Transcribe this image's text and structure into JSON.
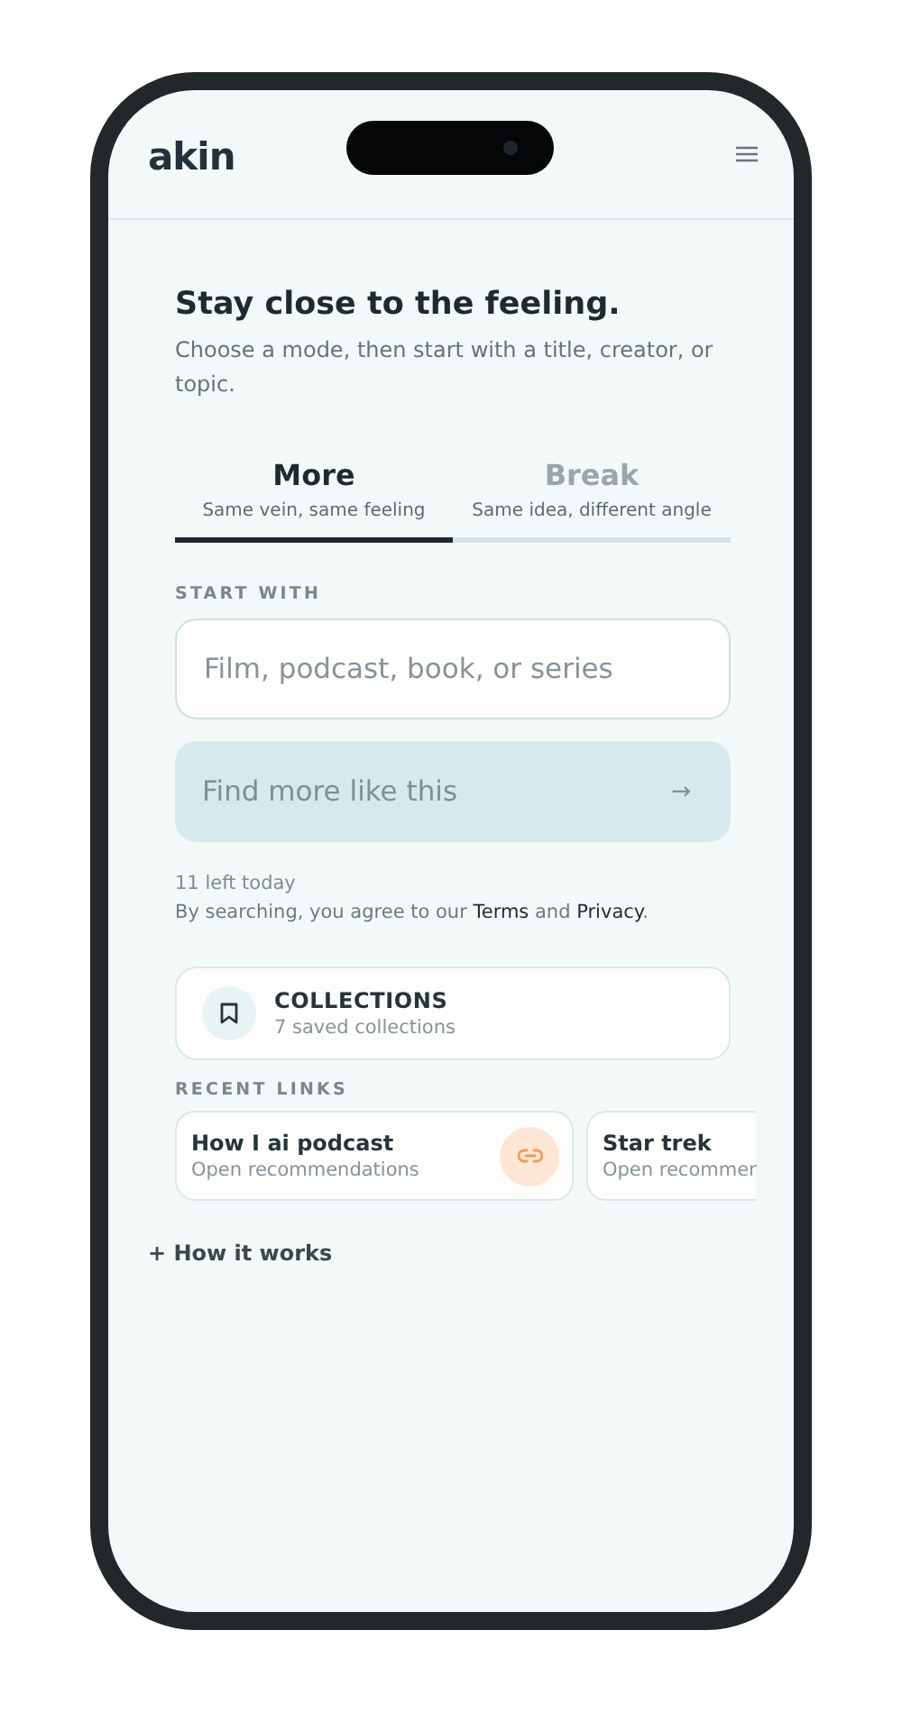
{
  "header": {
    "logo": "akin"
  },
  "intro": {
    "title": "Stay close to the feeling.",
    "subtitle": "Choose a mode, then start with a title, creator, or topic."
  },
  "modes": [
    {
      "label": "More",
      "caption": "Same vein, same feeling",
      "selected": true
    },
    {
      "label": "Break",
      "caption": "Same idea, different angle",
      "selected": false
    }
  ],
  "search": {
    "label": "START WITH",
    "placeholder": "Film, podcast, book, or series",
    "button": "Find more like this",
    "button_icon": "→",
    "disabled": true
  },
  "quota": "11 left today",
  "terms": "By searching, you agree to our **Terms** and **Privacy**.",
  "collections": {
    "title": "COLLECTIONS",
    "count": "7 saved collections"
  },
  "recent": {
    "label": "RECENT LINKS",
    "items": [
      {
        "title": "How I ai podcast",
        "subtitle": "Open recommendations",
        "icon": true
      },
      {
        "title": "Star trek",
        "subtitle": "Open recommer",
        "icon": false
      }
    ]
  },
  "how_it_works": "+ How it works"
}
